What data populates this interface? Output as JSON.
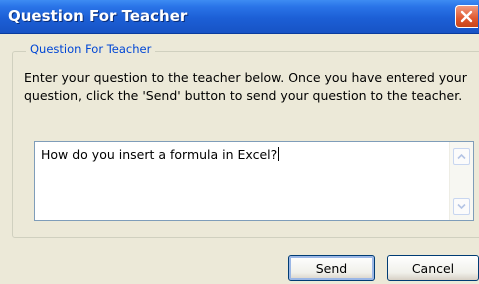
{
  "window": {
    "title": "Question For Teacher"
  },
  "group": {
    "label": "Question For Teacher",
    "instructions": "Enter your question to the teacher below. Once you have entered your question, click the 'Send' button to send your question to the teacher."
  },
  "question_input": {
    "value": "How do you insert a formula in Excel?"
  },
  "buttons": {
    "send_label": "Send",
    "cancel_label": "Cancel"
  },
  "icons": {
    "close": "close-icon",
    "scroll_up": "scroll-up-arrow-icon",
    "scroll_down": "scroll-down-arrow-icon"
  },
  "colors": {
    "titlebar": "#1c5fd6",
    "close_button": "#e0582e",
    "group_label": "#0046d5",
    "dialog_background": "#ece9d8"
  }
}
